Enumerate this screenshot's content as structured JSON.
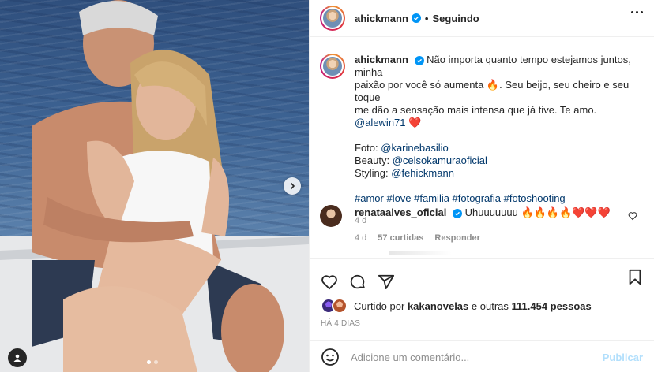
{
  "post": {
    "username": "ahickmann",
    "follow_status": "Seguindo",
    "separator": "•"
  },
  "caption": {
    "username": "ahickmann",
    "text_line1": "Não importa quanto tempo estejamos juntos, minha",
    "text_line2": "paixão por você só aumenta 🔥. Seu beijo, seu cheiro e seu toque",
    "text_line3": "me dão a sensação mais intensa que já tive. Te amo.",
    "mention_partner": "@alewin71",
    "heart": "❤️",
    "foto_label": "Foto:",
    "foto_handle": "@karinebasilio",
    "beauty_label": "Beauty:",
    "beauty_handle": "@celsokamuraoficial",
    "styling_label": "Styling:",
    "styling_handle": "@fehickmann",
    "hashtags": "#amor #love #familia #fotografia #fotoshooting",
    "time": "4 d"
  },
  "comment": {
    "username": "renataalves_oficial",
    "text": "Uhuuuuuuu 🔥🔥🔥🔥❤️❤️❤️",
    "time": "4 d",
    "likes": "57 curtidas",
    "reply": "Responder"
  },
  "likes": {
    "prefix": "Curtido por",
    "user": "kakanovelas",
    "suffix": "e outras",
    "count": "111.454 pessoas"
  },
  "date": "HÁ 4 DIAS",
  "composer": {
    "placeholder": "Adicione um comentário...",
    "publish": "Publicar"
  },
  "carousel": {
    "slides": 2,
    "active_slide": 1
  },
  "colors": {
    "verified": "#0095f6",
    "link": "#00376b",
    "muted": "#8e8e8e",
    "publish_disabled": "#b2dffc"
  },
  "icons": [
    "heart-icon",
    "comment-icon",
    "share-icon",
    "bookmark-icon",
    "emoji-icon",
    "more-icon",
    "chevron-right-icon",
    "user-tag-icon"
  ]
}
